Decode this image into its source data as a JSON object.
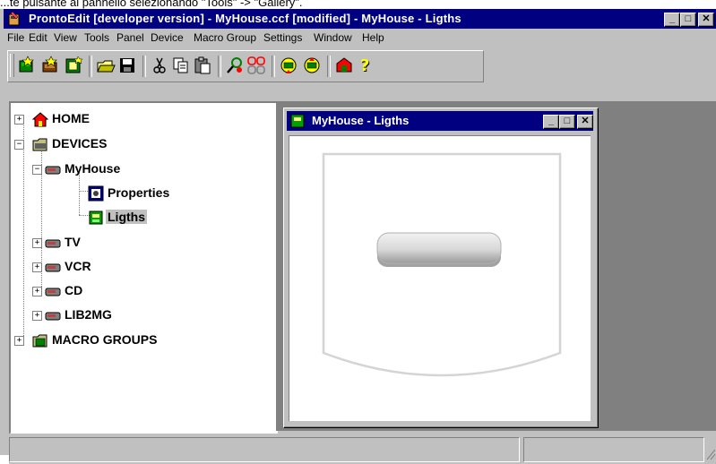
{
  "caption": "...te pulsante al pannello selezionando \"Tools\" -> \"Gallery\".",
  "window": {
    "title": "ProntoEdit [developer version] - MyHouse.ccf [modified] - MyHouse - Ligths",
    "min_glyph": "_",
    "max_glyph": "□",
    "close_glyph": "✕"
  },
  "menu": [
    {
      "label": "File"
    },
    {
      "label": "Edit"
    },
    {
      "label": "View"
    },
    {
      "label": "Tools"
    },
    {
      "label": "Panel"
    },
    {
      "label": "Device"
    },
    {
      "label": "Macro Group"
    },
    {
      "label": "Settings"
    },
    {
      "label": "Window"
    },
    {
      "label": "Help"
    }
  ],
  "toolbar": {
    "icons": [
      "new-device-icon",
      "new-panel-icon",
      "new-frame-icon",
      "open-icon",
      "save-icon",
      "cut-icon",
      "copy-icon",
      "paste-icon",
      "properties-icon",
      "gallery-icon",
      "download-icon",
      "upload-icon",
      "emulator-icon",
      "help-icon"
    ]
  },
  "tree": {
    "home": "HOME",
    "devices": "DEVICES",
    "myhouse": "MyHouse",
    "properties": "Properties",
    "ligths": "Ligths",
    "tv": "TV",
    "vcr": "VCR",
    "cd": "CD",
    "lib2mg": "LIB2MG",
    "macro_groups": "MACRO GROUPS",
    "expand_plus": "+",
    "expand_minus": "−"
  },
  "child_window": {
    "title": "MyHouse - Ligths"
  },
  "colors": {
    "titlebar": "#000080",
    "chrome": "#c0c0c0",
    "mdi_background": "#808080"
  }
}
